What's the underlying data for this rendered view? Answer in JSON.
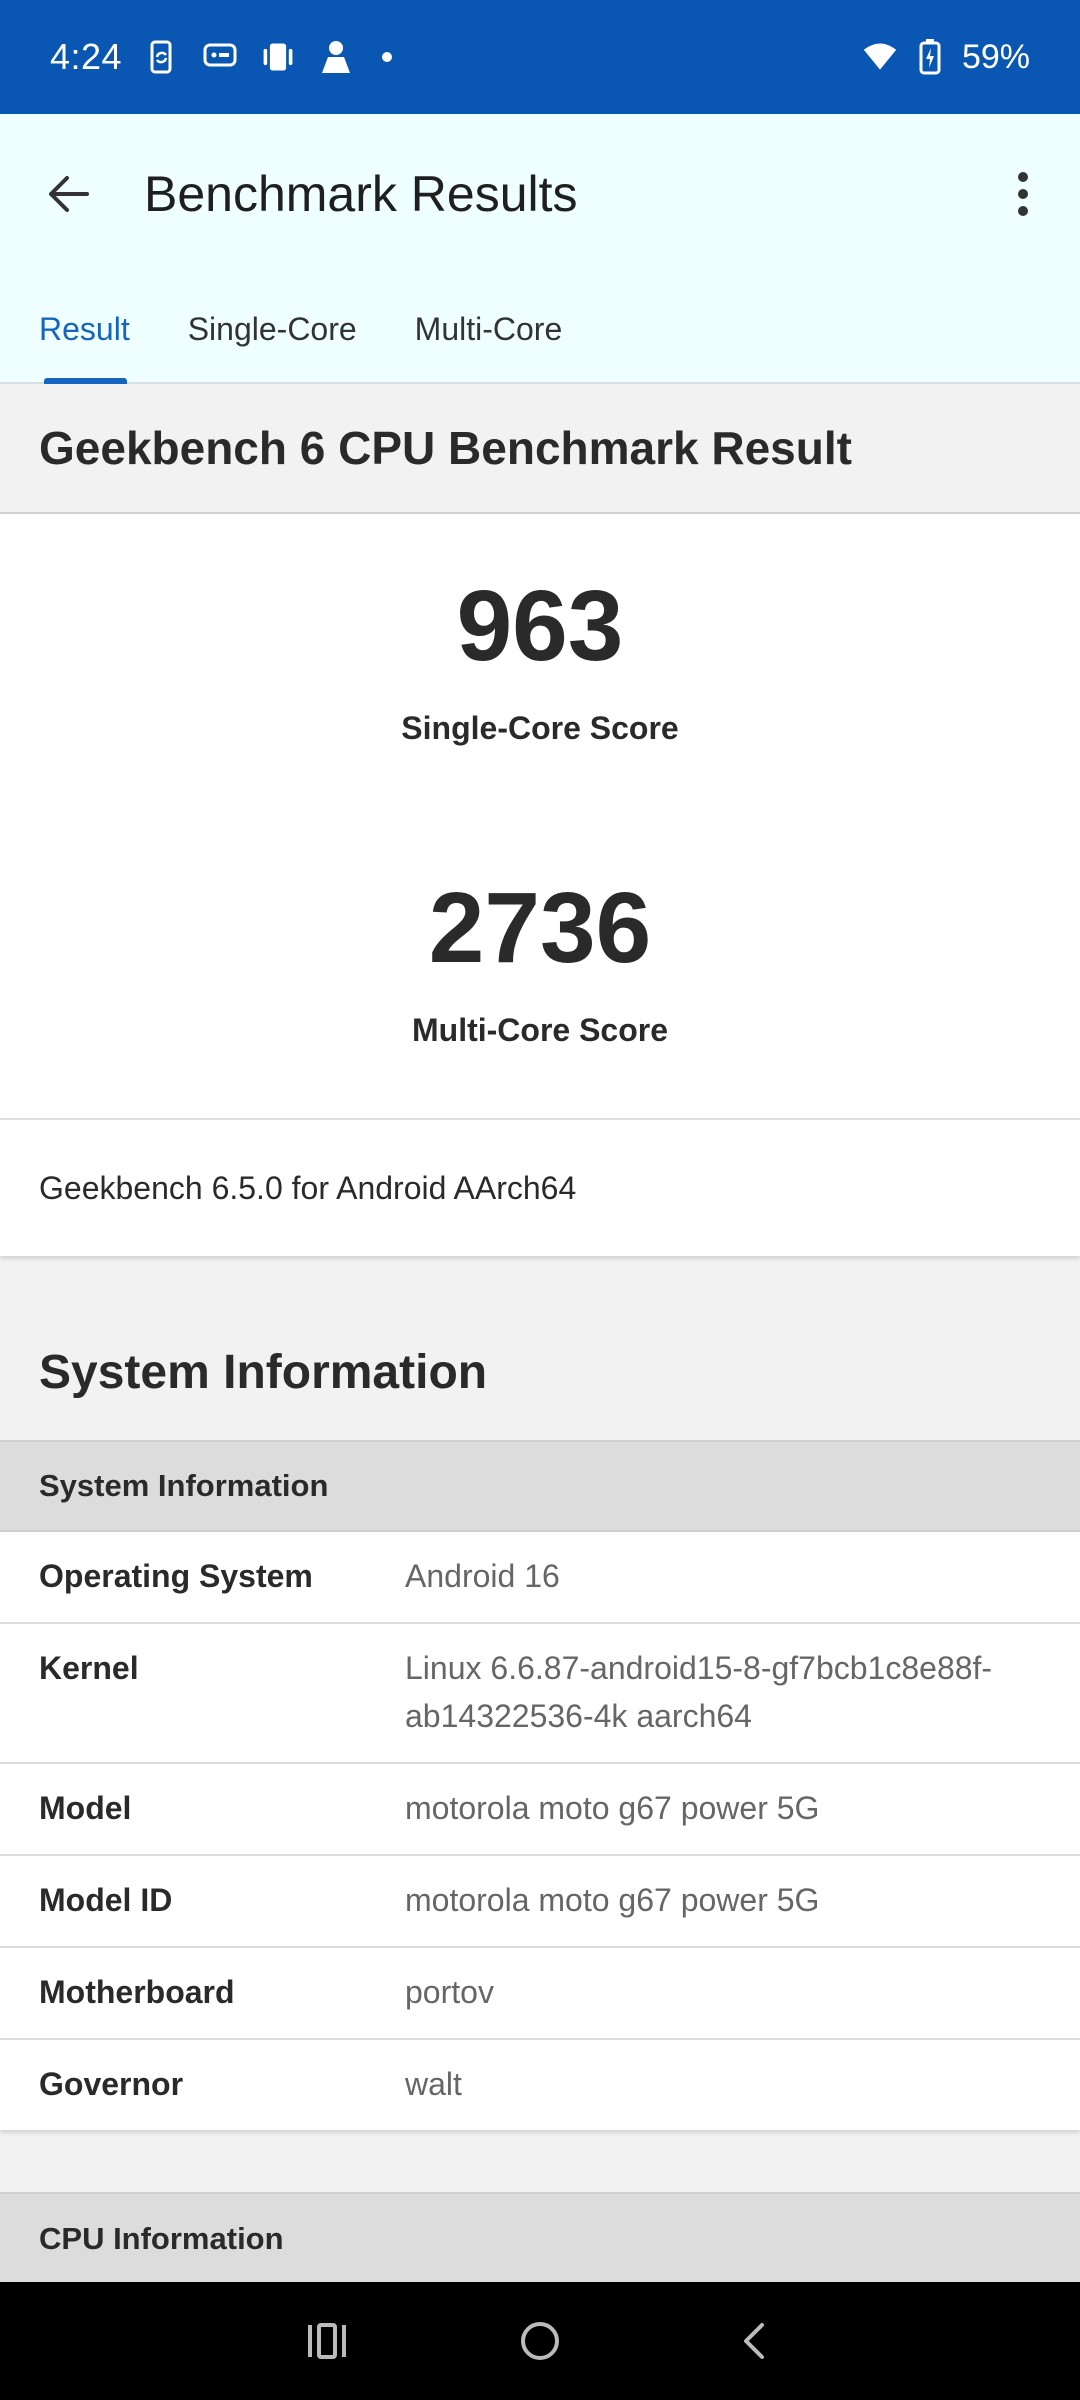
{
  "status_bar": {
    "time": "4:24",
    "battery": "59%",
    "icons": [
      "phone-sync-icon",
      "chat-bubble-icon",
      "vibrate-icon",
      "person-icon",
      "dot-icon",
      "wifi-icon",
      "battery-charging-icon"
    ]
  },
  "app_bar": {
    "title": "Benchmark Results",
    "tabs": [
      {
        "label": "Result",
        "active": true
      },
      {
        "label": "Single-Core",
        "active": false
      },
      {
        "label": "Multi-Core",
        "active": false
      }
    ],
    "accent_color": "#1565c0"
  },
  "result": {
    "title": "Geekbench 6 CPU Benchmark Result",
    "single_core": {
      "value": "963",
      "label": "Single-Core Score"
    },
    "multi_core": {
      "value": "2736",
      "label": "Multi-Core Score"
    },
    "version": "Geekbench 6.5.0 for Android AArch64"
  },
  "system_information": {
    "heading": "System Information",
    "table_header": "System Information",
    "rows": [
      {
        "key": "Operating System",
        "value": "Android 16"
      },
      {
        "key": "Kernel",
        "value": "Linux 6.6.87-android15-8-gf7bcb1c8e88f-ab14322536-4k aarch64"
      },
      {
        "key": "Model",
        "value": "motorola moto g67 power 5G"
      },
      {
        "key": "Model ID",
        "value": "motorola moto g67 power 5G"
      },
      {
        "key": "Motherboard",
        "value": "portov"
      },
      {
        "key": "Governor",
        "value": "walt"
      }
    ]
  },
  "cpu_information": {
    "table_header": "CPU Information"
  },
  "nav_bar": {
    "buttons": [
      "recents-icon",
      "home-icon",
      "back-nav-icon"
    ]
  }
}
